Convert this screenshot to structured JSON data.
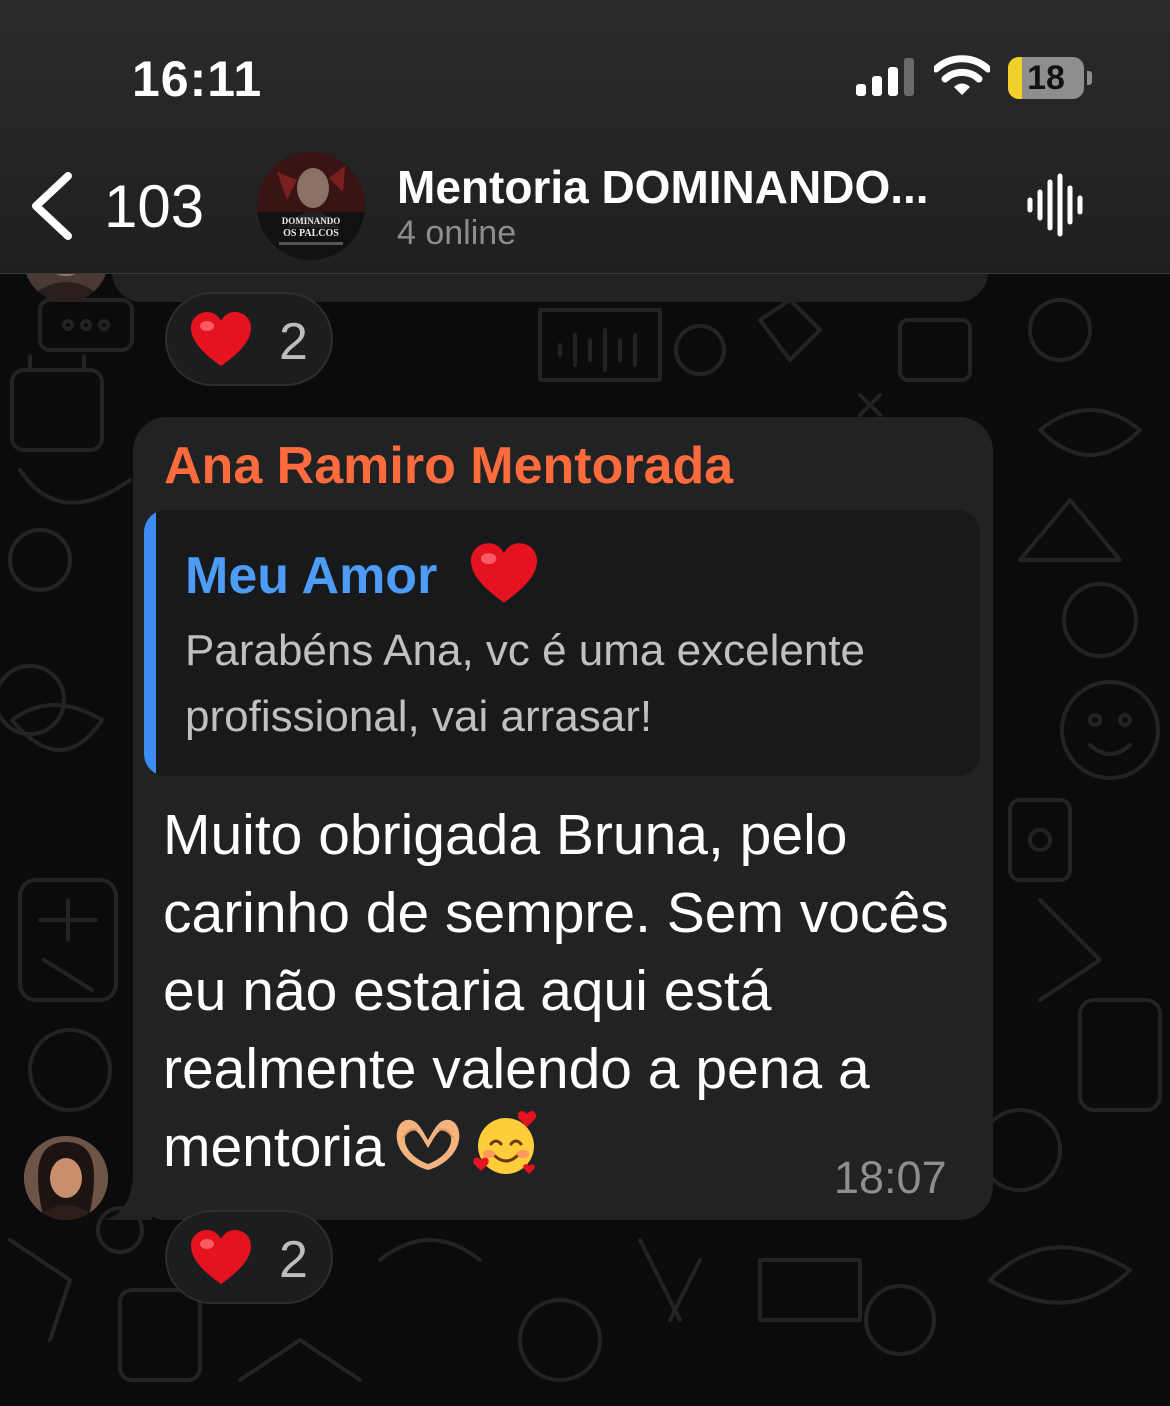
{
  "status_bar": {
    "time": "16:11",
    "battery_level": "18",
    "battery_fraction": 0.18
  },
  "header": {
    "back_count": "103",
    "group_title": "Mentoria DOMINANDO...",
    "group_status": "4 online",
    "avatar_text_line1": "DOMINANDO",
    "avatar_text_line2": "OS PALCOS"
  },
  "previous_message": {
    "reaction_emoji": "heart",
    "reaction_count": "2"
  },
  "message": {
    "sender": "Ana Ramiro Mentorada",
    "sender_color": "#ff6b3d",
    "reply": {
      "name": "Meu Amor",
      "name_emoji": "heart",
      "name_color": "#4d9cf7",
      "text": "Parabéns Ana, vc é uma excelente profissional, vai arrasar!"
    },
    "text": "Muito obrigada Bruna, pelo carinho de sempre. Sem vocês eu não estaria aqui está realmente valendo a pena a mentoria",
    "trailing_emojis": [
      "heart-hands",
      "smiling-face-with-hearts"
    ],
    "time": "18:07",
    "reaction_emoji": "heart",
    "reaction_count": "2"
  },
  "colors": {
    "accent_blue": "#3d8cf5",
    "bubble_bg": "#202224",
    "background": "#0b0b0b"
  }
}
